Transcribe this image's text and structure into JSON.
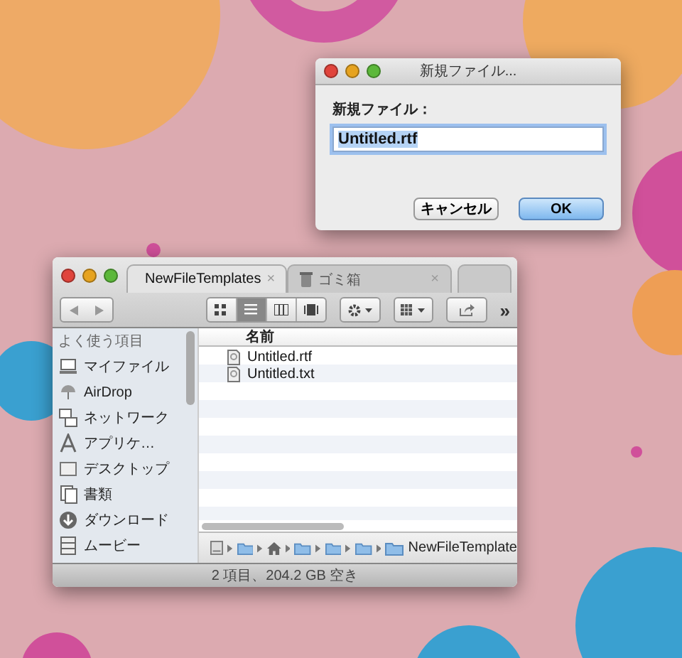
{
  "dialog": {
    "title": "新規ファイル...",
    "label": "新規ファイル：",
    "value": "Untitled.rtf",
    "value_selected": true,
    "buttons": [
      {
        "label": "キャンセル",
        "default": false
      },
      {
        "label": "OK",
        "default": true
      }
    ]
  },
  "finder": {
    "tabs": [
      {
        "label": "NewFileTemplates",
        "selected": true,
        "close": "×"
      },
      {
        "label": "ゴミ箱",
        "selected": false,
        "close": "×"
      }
    ],
    "views": [
      {
        "kind": "icon",
        "selected": false
      },
      {
        "kind": "list",
        "selected": true
      },
      {
        "kind": "column",
        "selected": false
      },
      {
        "kind": "coverflow",
        "selected": false
      }
    ],
    "overflow": "»",
    "sidebar": {
      "heading": "よく使う項目",
      "items": [
        {
          "kind": "home",
          "label": "マイファイル"
        },
        {
          "kind": "airdrop",
          "label": "AirDrop"
        },
        {
          "kind": "network",
          "label": "ネットワーク"
        },
        {
          "kind": "apps",
          "label": "アプリケ…"
        },
        {
          "kind": "desktop",
          "label": "デスクトップ"
        },
        {
          "kind": "documents",
          "label": "書類"
        },
        {
          "kind": "downloads",
          "label": "ダウンロード"
        },
        {
          "kind": "movies",
          "label": "ムービー"
        }
      ]
    },
    "column": "名前",
    "files": [
      {
        "name": "Untitled.rtf"
      },
      {
        "name": "Untitled.txt"
      }
    ],
    "path": [
      {
        "kind": "disk"
      },
      {
        "kind": "folder"
      },
      {
        "kind": "home"
      },
      {
        "kind": "folder"
      },
      {
        "kind": "folder"
      },
      {
        "kind": "folder"
      },
      {
        "kind": "folder",
        "label": "NewFileTemplate"
      }
    ],
    "status": "2 項目、204.2 GB 空き"
  }
}
